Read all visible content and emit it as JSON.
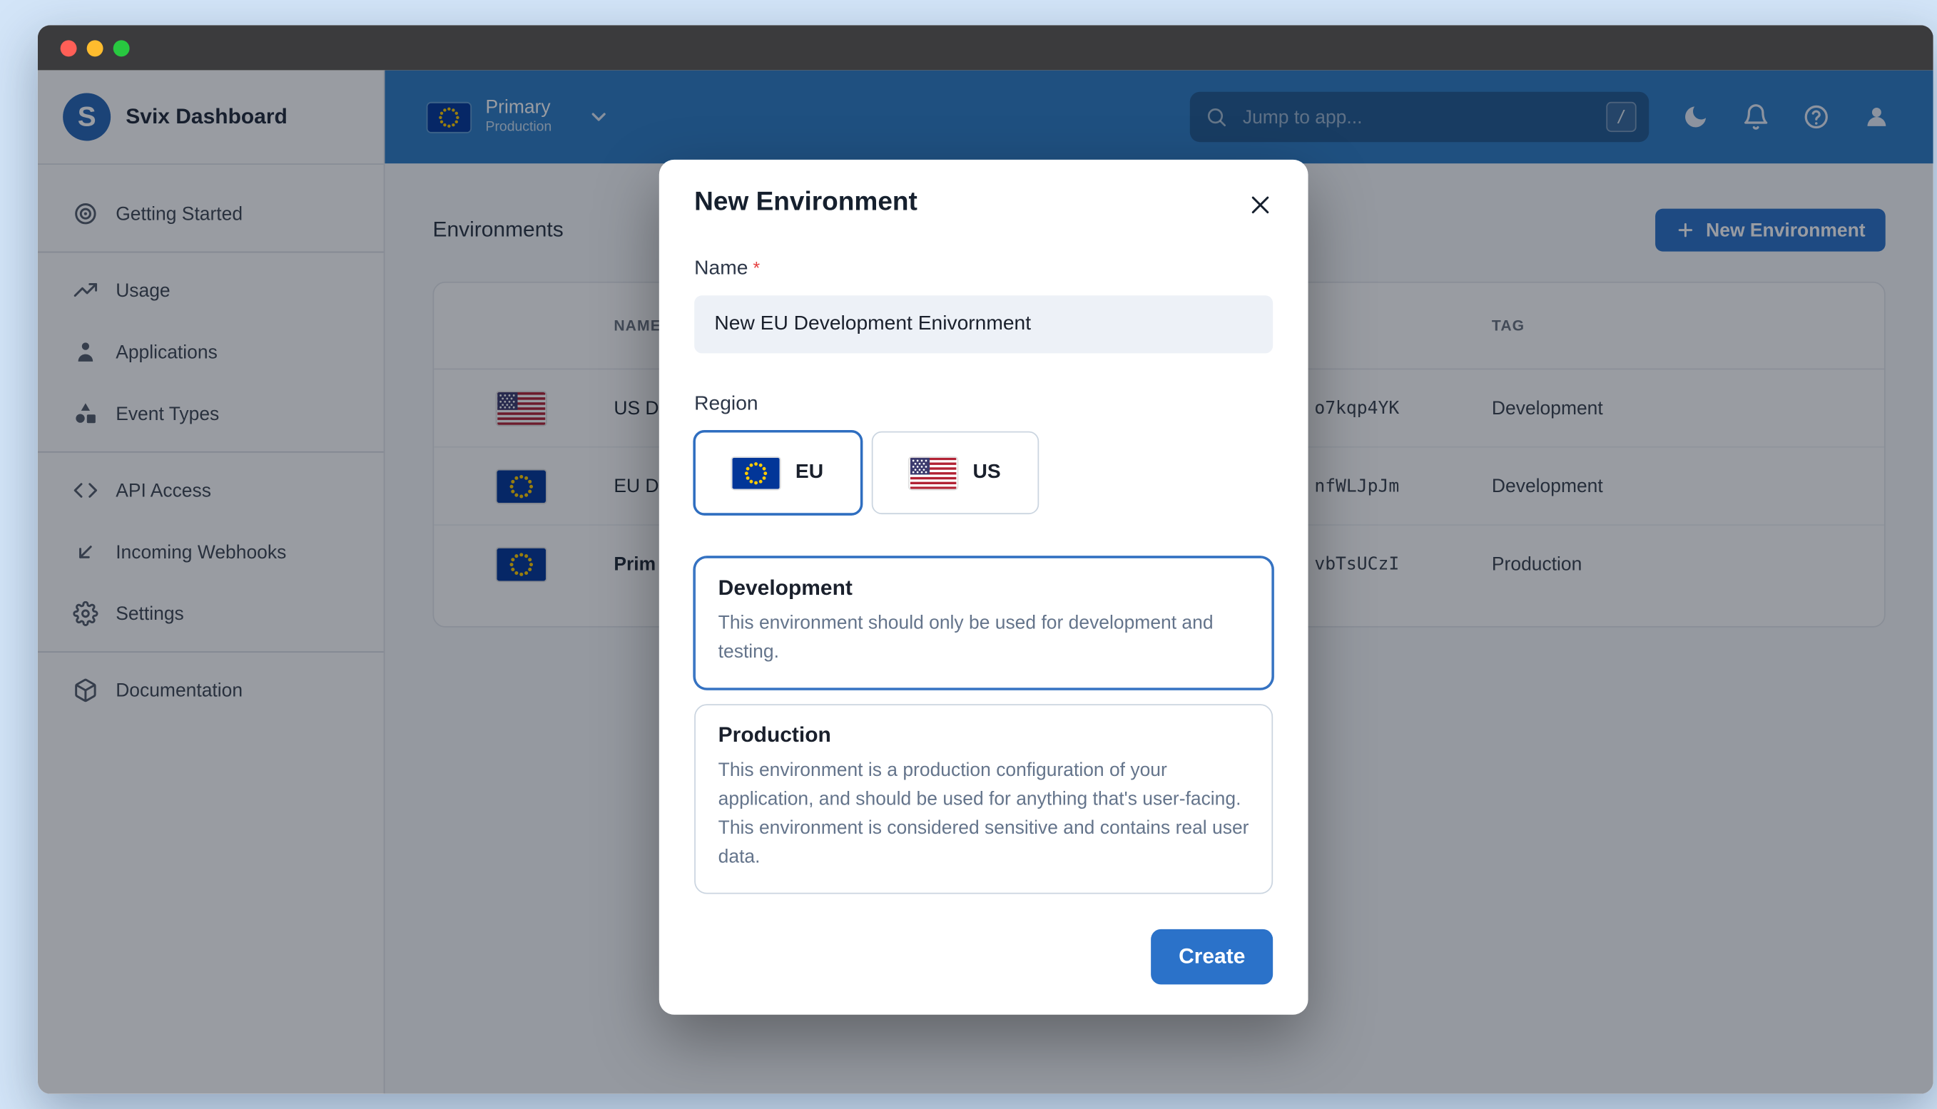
{
  "window": {
    "titlebar_controls": [
      "close",
      "minimize",
      "zoom"
    ]
  },
  "topbar": {
    "environment_switcher": {
      "name": "Primary",
      "tag": "Production",
      "flag": "eu",
      "chevron_icon": "chevron-down-icon"
    },
    "search": {
      "placeholder": "Jump to app...",
      "shortcut_key": "/"
    },
    "icons": [
      "moon-icon",
      "bell-icon",
      "help-icon",
      "user-icon"
    ]
  },
  "sidebar": {
    "brand": "Svix Dashboard",
    "logo_icon": "svix-logo",
    "items": [
      {
        "label": "Getting Started",
        "icon": "target-icon"
      },
      {
        "label": "Usage",
        "icon": "trending-up-icon"
      },
      {
        "label": "Applications",
        "icon": "person-icon"
      },
      {
        "label": "Event Types",
        "icon": "shapes-icon"
      },
      {
        "label": "API Access",
        "icon": "code-icon"
      },
      {
        "label": "Incoming Webhooks",
        "icon": "arrow-down-left-icon"
      },
      {
        "label": "Settings",
        "icon": "gear-icon"
      },
      {
        "label": "Documentation",
        "icon": "package-icon"
      }
    ]
  },
  "main": {
    "title": "Environments",
    "new_environment_button": "New Environment",
    "table": {
      "headers": {
        "name": "NAME",
        "tag": "TAG"
      },
      "rows": [
        {
          "flag": "us",
          "name_visible": "US D",
          "id_visible": "o7kqp4YK",
          "tag": "Development",
          "bold": false
        },
        {
          "flag": "eu",
          "name_visible": "EU D",
          "id_visible": "nfWLJpJm",
          "tag": "Development",
          "bold": false
        },
        {
          "flag": "eu",
          "name_visible": "Prim",
          "id_visible": "vbTsUCzI",
          "tag": "Production",
          "bold": true
        }
      ]
    }
  },
  "modal": {
    "title": "New Environment",
    "close_icon": "close-icon",
    "name_label": "Name",
    "required_marker": "*",
    "name_value": "New EU Development Enivornment",
    "region_label": "Region",
    "regions": [
      {
        "label": "EU",
        "flag": "eu",
        "selected": true
      },
      {
        "label": "US",
        "flag": "us",
        "selected": false
      }
    ],
    "environment_types": [
      {
        "title": "Development",
        "description": "This environment should only be used for development and testing.",
        "selected": true
      },
      {
        "title": "Production",
        "description": "This environment is a production configuration of your application, and should be used for anything that's user-facing. This environment is considered sensitive and contains real user data.",
        "selected": false
      }
    ],
    "create_button": "Create"
  },
  "colors": {
    "accent_blue": "#2b72c9",
    "topbar_blue": "#2e7cc4",
    "selected_border": "#2f6ec0",
    "required_red": "#e53e3e",
    "desktop_background": "#d3e5f8"
  }
}
